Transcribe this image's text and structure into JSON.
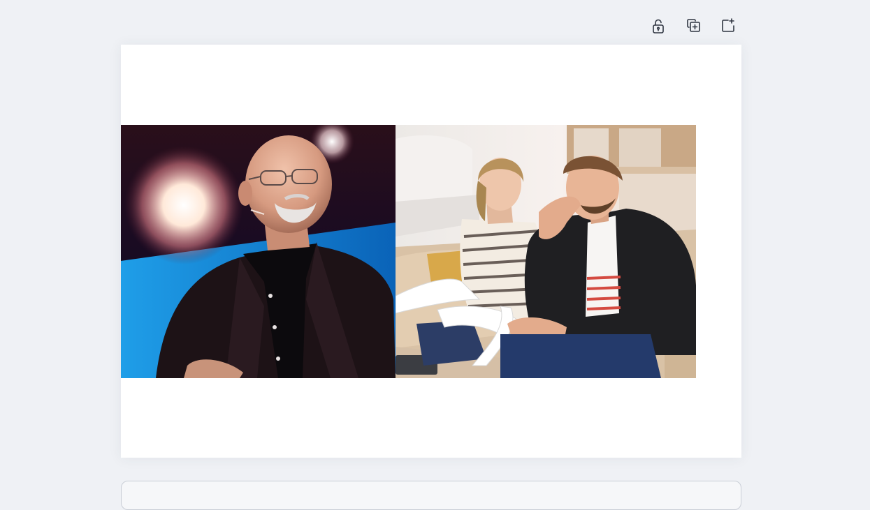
{
  "toolbar": {
    "buttons": [
      {
        "icon": "unlock-icon"
      },
      {
        "icon": "duplicate-page-icon"
      },
      {
        "icon": "add-page-icon"
      }
    ]
  },
  "canvas": {
    "images": [
      {
        "icon": "speaker-on-stage-photo"
      },
      {
        "icon": "stressed-couple-with-bills-photo"
      }
    ]
  },
  "colors": {
    "background": "#eff1f5",
    "page": "#ffffff",
    "icon_stroke": "#2e3440"
  }
}
